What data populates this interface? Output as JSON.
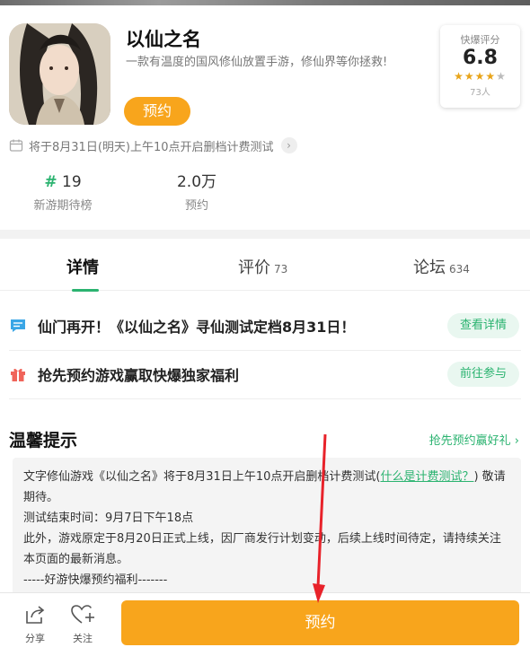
{
  "game": {
    "title": "以仙之名",
    "description": "一款有温度的国风修仙放置手游，修仙界等你拯救!",
    "reserve_label": "预约"
  },
  "rating": {
    "label": "快爆评分",
    "score": "6.8",
    "stars": 3.5,
    "count": "73人"
  },
  "test_notice": {
    "text": "将于8月31日(明天)上午10点开启删档计费测试"
  },
  "stats": [
    {
      "hash": "#",
      "value": "19",
      "label": "新游期待榜"
    },
    {
      "value": "2.0万",
      "label": "预约"
    }
  ],
  "tabs": [
    {
      "label": "详情",
      "count": ""
    },
    {
      "label": "评价",
      "count": "73"
    },
    {
      "label": "论坛",
      "count": "634"
    }
  ],
  "announcements": [
    {
      "text": "仙门再开！《以仙之名》寻仙测试定档8月31日！",
      "button": "查看详情",
      "icon": "message-icon"
    },
    {
      "text": "抢先预约游戏赢取快爆独家福利",
      "button": "前往参与",
      "icon": "gift-icon"
    }
  ],
  "tips": {
    "title": "温馨提示",
    "link": "抢先预约赢好礼",
    "line1_pre": "文字修仙游戏《以仙之名》将于8月31日上午10点开启删档计费测试(",
    "line1_link": "什么是计费测试？",
    "line1_post": ") 敬请期待。",
    "line2": "测试结束时间：9月7日下午18点",
    "line3": "此外，游戏原定于8月20日正式上线，因厂商发行计划变动，后续上线时间待定，请持续关注本页面的最新消息。",
    "line4": "-----好游快爆预约福利-------"
  },
  "bottom": {
    "share": "分享",
    "follow": "关注",
    "reserve": "预约"
  },
  "colors": {
    "accent_green": "#2bb370",
    "accent_orange": "#f8a51c",
    "annotation_red": "#e8222a"
  }
}
